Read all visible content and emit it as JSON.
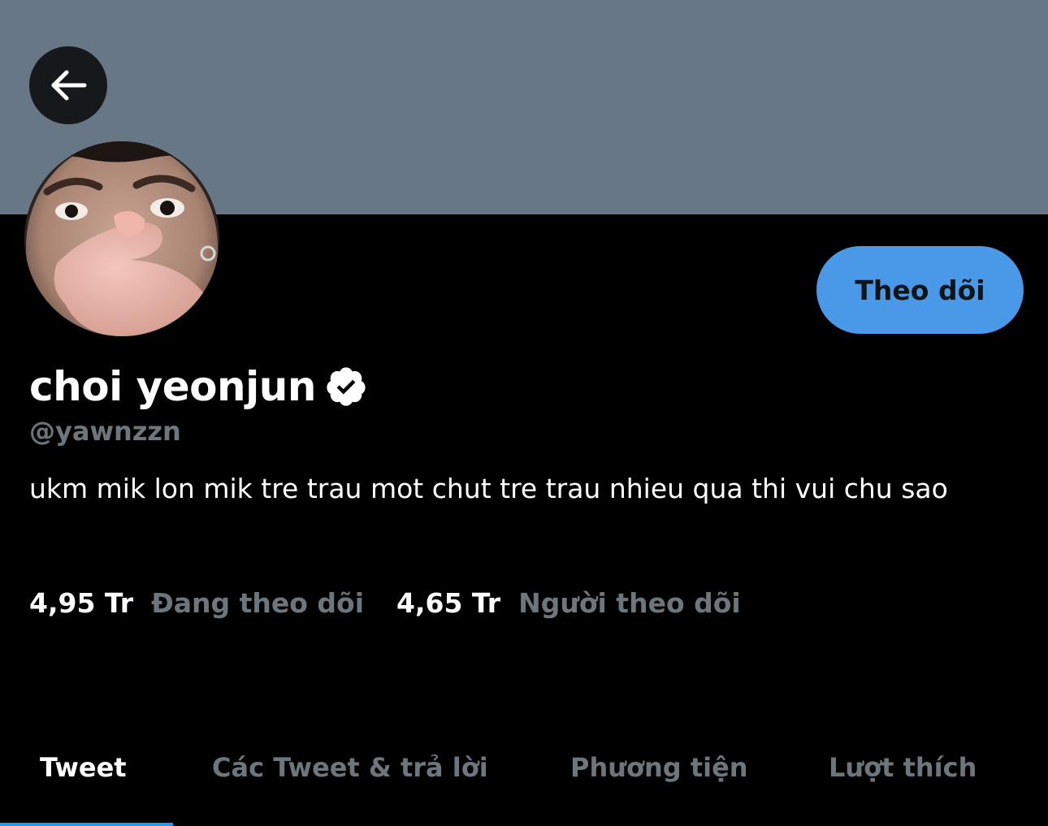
{
  "header": {
    "back_icon": "arrow-left-icon",
    "banner_color": "#687785"
  },
  "profile": {
    "display_name": "choi yeonjun",
    "verified_icon": "verified-badge-icon",
    "handle": "@yawnzzn",
    "bio": "ukm mik lon mik tre trau mot chut tre trau nhieu qua thi vui chu sao",
    "follow_label": "Theo dõi",
    "follow_color": "#4a99e9"
  },
  "stats": {
    "following_count": "4,95 Tr",
    "following_label": "Đang theo dõi",
    "followers_count": "4,65 Tr",
    "followers_label": "Người theo dõi"
  },
  "tabs": [
    {
      "label": "Tweet",
      "active": true
    },
    {
      "label": "Các Tweet & trả lời",
      "active": false
    },
    {
      "label": "Phương tiện",
      "active": false
    },
    {
      "label": "Lượt thích",
      "active": false
    }
  ]
}
